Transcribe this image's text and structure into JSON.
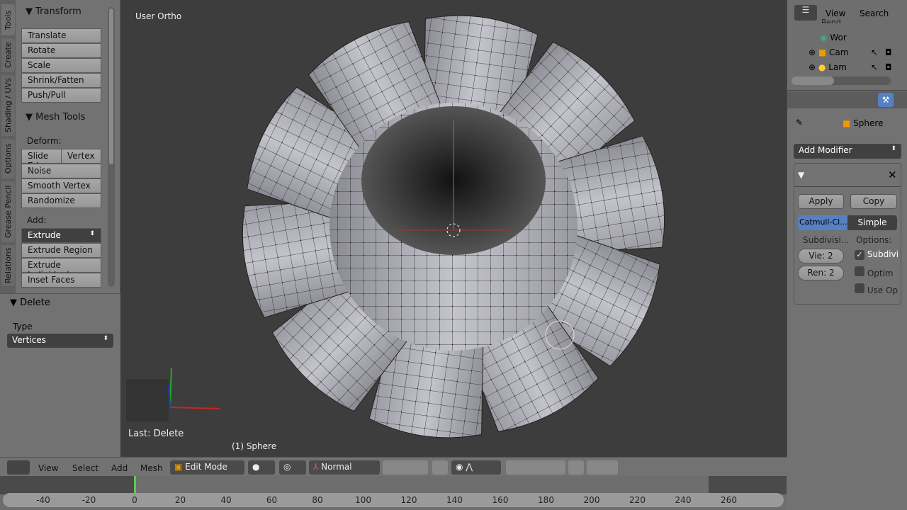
{
  "tool_tabs": [
    "Tools",
    "Create",
    "Shading / UVs",
    "Options",
    "Grease Pencil",
    "Relations"
  ],
  "transform": {
    "title": "Transform",
    "buttons": [
      "Translate",
      "Rotate",
      "Scale",
      "Shrink/Fatten",
      "Push/Pull"
    ]
  },
  "mesh_tools": {
    "title": "Mesh Tools",
    "deform_label": "Deform:",
    "slide": "Slide Ed",
    "vertex": "Vertex",
    "deform": [
      "Noise",
      "Smooth Vertex",
      "Randomize"
    ],
    "add_label": "Add:",
    "extrude": "Extrude",
    "add": [
      "Extrude Region",
      "Extrude Individual",
      "Inset Faces"
    ]
  },
  "delete_panel": {
    "title": "Delete",
    "type_label": "Type",
    "type_value": "Vertices"
  },
  "viewport": {
    "view_name": "User Ortho",
    "last_op": "Last: Delete",
    "object_label": "(1) Sphere"
  },
  "outliner": {
    "view": "View",
    "search": "Search",
    "items": [
      "Rend",
      "Wor",
      "Cam",
      "Lam"
    ]
  },
  "properties": {
    "object": "Sphere",
    "add_modifier": "Add Modifier",
    "apply": "Apply",
    "copy": "Copy",
    "catmull": "Catmull-Cl...",
    "simple": "Simple",
    "subdiv_label": "Subdivisi...",
    "options_label": "Options:",
    "view_levels": "Vie: 2",
    "render_levels": "Ren: 2",
    "checks": [
      {
        "label": "Subdivi",
        "checked": true
      },
      {
        "label": "Optim",
        "checked": false
      },
      {
        "label": "Use Op",
        "checked": false
      }
    ],
    "accent": "#5680c2"
  },
  "header": {
    "menus": [
      "View",
      "Select",
      "Add",
      "Mesh"
    ],
    "mode": "Edit Mode",
    "orientation": "Normal"
  },
  "timeline": {
    "ticks": [
      -40,
      -20,
      0,
      20,
      40,
      60,
      80,
      100,
      120,
      140,
      160,
      180,
      200,
      220,
      240,
      260
    ],
    "current_frame": 0
  }
}
